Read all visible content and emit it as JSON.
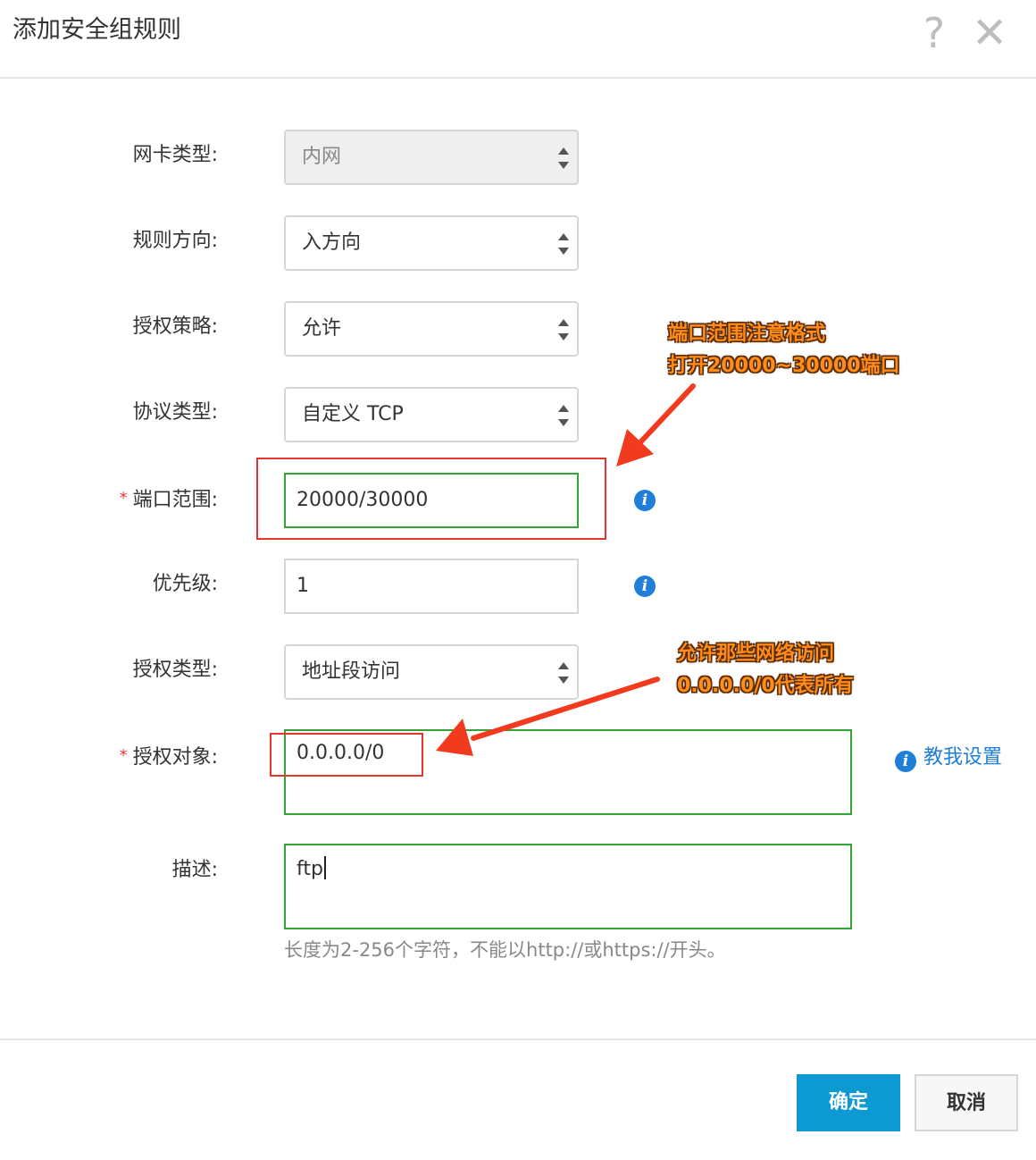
{
  "dialog": {
    "title": "添加安全组规则",
    "help_symbol": "?",
    "close_symbol": "✕"
  },
  "fields": {
    "nic_type": {
      "label": "网卡类型:",
      "value": "内网"
    },
    "direction": {
      "label": "规则方向:",
      "value": "入方向"
    },
    "policy": {
      "label": "授权策略:",
      "value": "允许"
    },
    "protocol": {
      "label": "协议类型:",
      "value": "自定义 TCP"
    },
    "port_range": {
      "required_mark": "*",
      "label": "端口范围:",
      "value": "20000/30000"
    },
    "priority": {
      "label": "优先级:",
      "value": "1"
    },
    "auth_type": {
      "label": "授权类型:",
      "value": "地址段访问"
    },
    "auth_object": {
      "required_mark": "*",
      "label": "授权对象:",
      "value": "0.0.0.0/0",
      "help_link": "教我设置"
    },
    "description": {
      "label": "描述:",
      "value": "ftp",
      "hint": "长度为2-256个字符，不能以http://或https://开头。"
    }
  },
  "info_icon_glyph": "i",
  "annotations": {
    "port_note_line1": "端口范围注意格式",
    "port_note_line2": "打开20000~30000端口",
    "auth_note_line1": "允许那些网络访问",
    "auth_note_line2": "0.0.0.0/0代表所有"
  },
  "footer": {
    "ok_label": "确定",
    "cancel_label": "取消"
  },
  "colors": {
    "primary_button": "#0d9ad3",
    "info_icon": "#1f7fd6",
    "annotation_red": "#e8322c",
    "valid_border": "#34a534",
    "note_text": "#ff8c1a"
  }
}
